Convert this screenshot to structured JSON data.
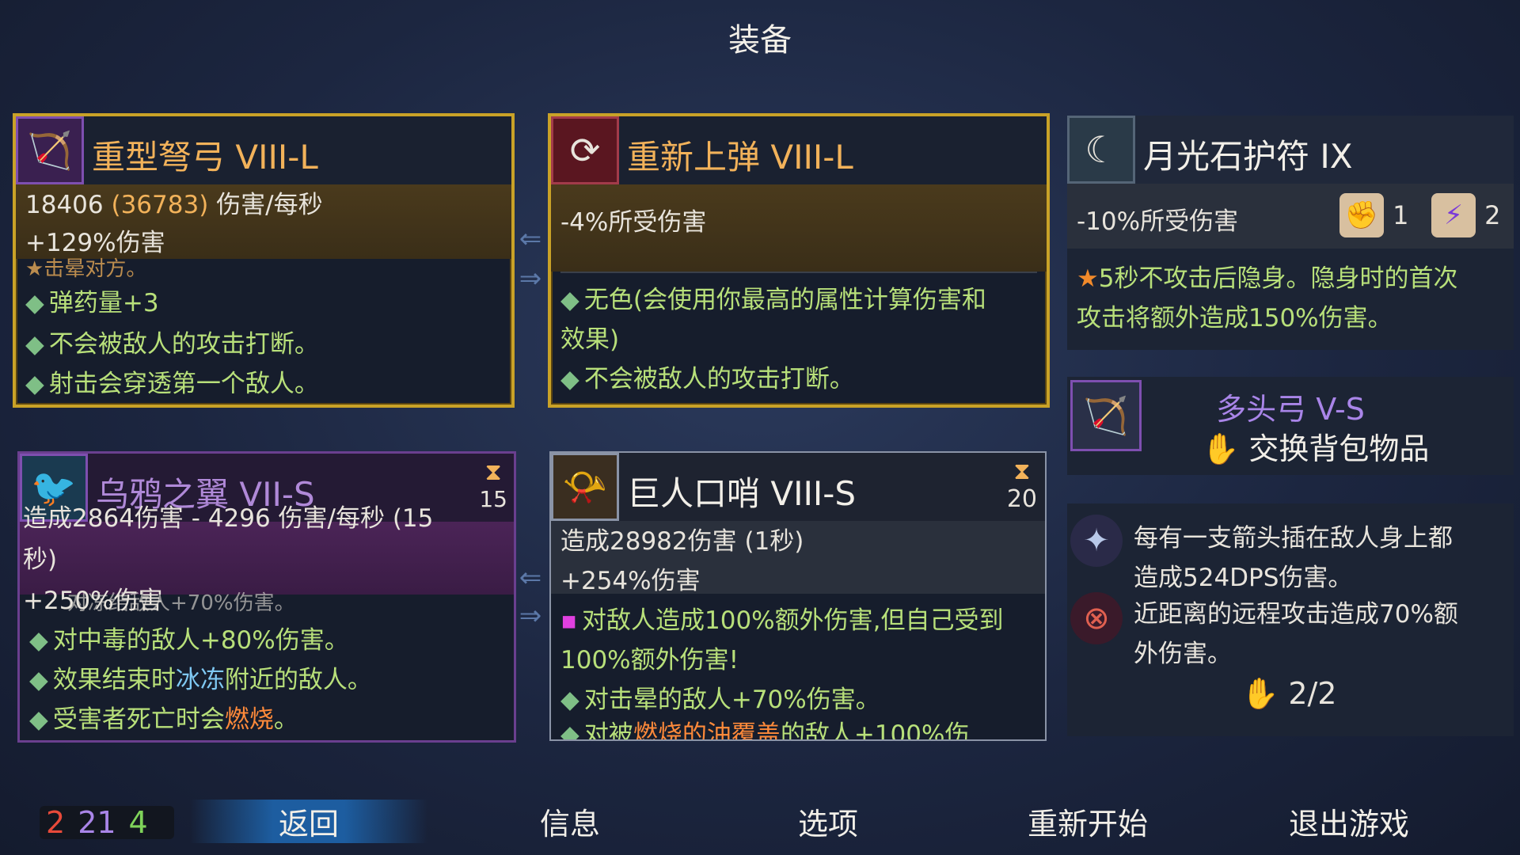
{
  "screen_title": "装备",
  "weapon1": {
    "name": "重型弩弓 VIII-L",
    "stat_dps": "18406",
    "stat_dps_crit": "(36783)",
    "stat_dps_unit": "伤害/每秒",
    "bonus": "+129%伤害",
    "partial_line": "击晕对方。",
    "lines": [
      "弹药量+3",
      "不会被敌人的攻击打断。",
      "射击会穿透第一个敌人。"
    ]
  },
  "weapon2": {
    "name": "重新上弹 VIII-L",
    "bonus": "-4%所受伤害",
    "lines": [
      "无色(会使用你最高的属性计算伤害和",
      "效果)",
      "不会被敌人的攻击打断。"
    ]
  },
  "amulet": {
    "name": "月光石护符 IX",
    "bonus": "-10%所受伤害",
    "scroll_red_count": "1",
    "scroll_purple_count": "2",
    "desc1": "5秒不攻击后隐身。隐身时的首次",
    "desc2": "攻击将额外造成150%伤害。"
  },
  "skill1": {
    "name": "乌鸦之翼 VII-S",
    "cooldown": "15",
    "stat_line1": "造成2864伤害 - 4296 伤害/每秒 (15",
    "stat_line1_hidden": "15",
    "stat_line2": "秒)",
    "bonus": "+250%伤害",
    "partial_line": "对冻结敌人+70%伤害。",
    "line1_pre": "对",
    "line1_hl": "中毒",
    "line1_post": "的敌人+80%伤害。",
    "line2_pre": "效果结束时",
    "line2_hl": "冰冻",
    "line2_post": "附近的敌人。",
    "line3_pre": "受害者死亡时会",
    "line3_hl": "燃烧",
    "line3_post": "。"
  },
  "skill2": {
    "name": "巨人口哨 VIII-S",
    "cooldown": "20",
    "stat": "造成28982伤害 (1秒)",
    "bonus": "+254%伤害",
    "line1": "对敌人造成100%额外伤害,但自己受到",
    "line2": "100%额外伤害!",
    "line3": "对击晕的敌人+70%伤害。",
    "partial_pre": "对被",
    "partial_hl": "燃烧的油覆盖",
    "partial_post": "的敌人+100%伤"
  },
  "backpack": {
    "name": "多头弓 V-S",
    "action": "交换背包物品"
  },
  "mutations": {
    "m1_line1": "每有一支箭头插在敌人身上都",
    "m1_line2": "造成524DPS伤害。",
    "m2_line1": "近距离的远程攻击造成70%额",
    "m2_line2": "外伤害。",
    "slots": "2/2"
  },
  "counter": {
    "red": "2",
    "purple": "21",
    "green": "4"
  },
  "menu": {
    "back": "返回",
    "info": "信息",
    "options": "选项",
    "restart": "重新开始",
    "quit": "退出游戏"
  },
  "colors": {
    "red": "#e84a3a",
    "purple": "#a985e8",
    "green": "#7fd35a",
    "gold": "#f2b25a"
  }
}
